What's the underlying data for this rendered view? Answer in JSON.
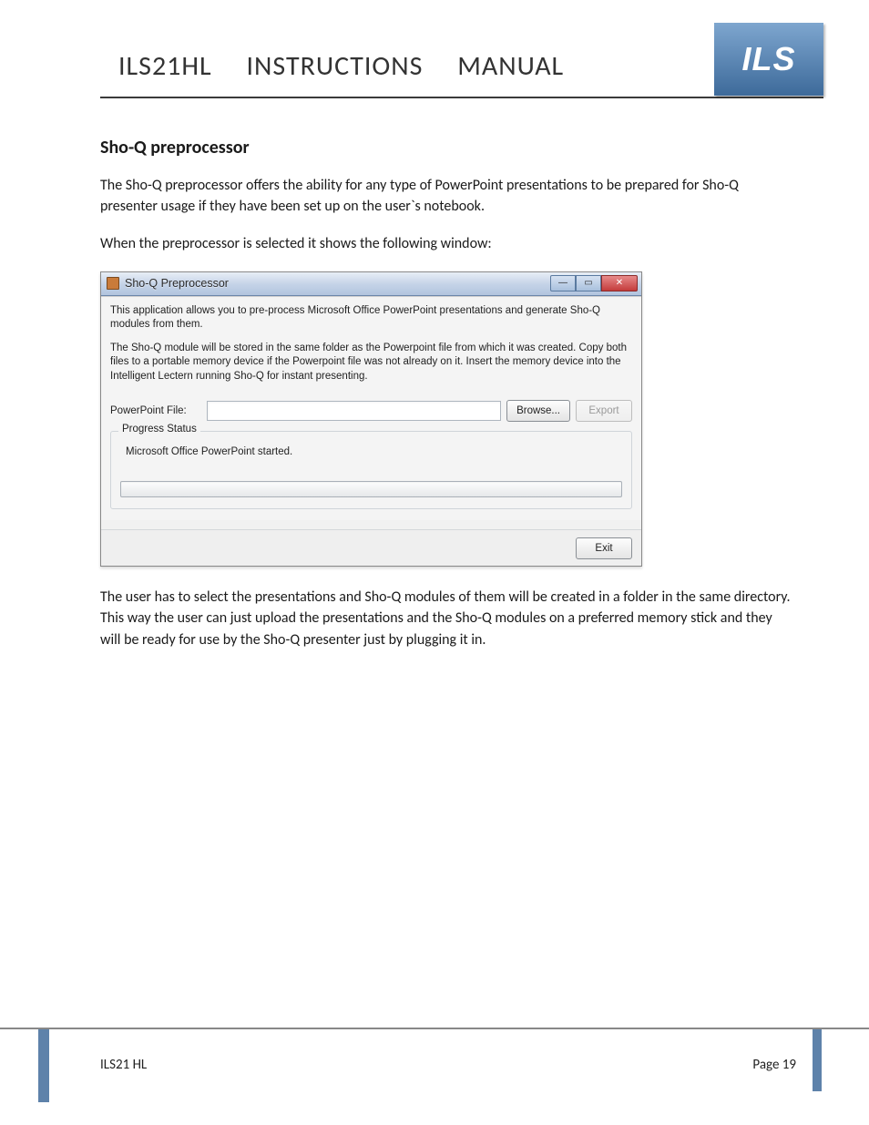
{
  "header": {
    "title": "ILS21HL INSTRUCTIONS MANUAL",
    "logo_text": "ILS"
  },
  "section": {
    "heading": "Sho-Q preprocessor",
    "para1": "The Sho-Q preprocessor offers the ability for any type of PowerPoint presentations to be prepared for Sho-Q presenter usage if they have been set up on the user`s notebook.",
    "para2": "When the preprocessor is selected it shows the following window:",
    "para3": "The user has to select the presentations and Sho-Q modules of them will be created in a folder in the same directory. This way the user can just upload the presentations and the Sho-Q modules on a preferred memory stick and they will be ready for use by the Sho-Q presenter just by plugging it in."
  },
  "app": {
    "title": "Sho-Q Preprocessor",
    "min_glyph": "—",
    "max_glyph": "▭",
    "close_glyph": "✕",
    "desc1": "This application allows you to pre-process Microsoft Office PowerPoint presentations and generate Sho-Q modules from them.",
    "desc2": "The Sho-Q module will be stored in the same folder as the Powerpoint file from which it was created. Copy both files to a portable memory device if the Powerpoint file was not already on it. Insert the memory device into the Intelligent Lectern running Sho-Q for instant presenting.",
    "file_label": "PowerPoint File:",
    "file_value": "",
    "browse_label": "Browse...",
    "export_label": "Export",
    "group_label": "Progress Status",
    "status_text": "Microsoft Office PowerPoint started.",
    "exit_label": "Exit"
  },
  "footer": {
    "left": "ILS21 HL",
    "right": "Page 19"
  }
}
